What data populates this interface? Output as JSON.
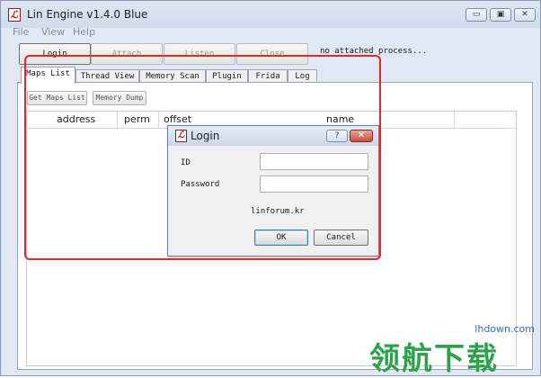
{
  "window": {
    "title": "Lin Engine v1.4.0 Blue",
    "app_icon": "ℒ",
    "controls": [
      "▭",
      "▣",
      "✕"
    ]
  },
  "menu": [
    "File",
    "View",
    "Help"
  ],
  "toolbar": {
    "buttons": [
      "Login",
      "Attach",
      "Listen",
      "Close"
    ],
    "status": "no attached process..."
  },
  "tabs": [
    "Maps List",
    "Thread View",
    "Memory Scan",
    "Plugin",
    "Frida",
    "Log"
  ],
  "maps_list": {
    "buttons": [
      "Get Maps List",
      "Memory Dump"
    ],
    "columns": [
      "address",
      "perm",
      "offset",
      "name"
    ]
  },
  "login_dialog": {
    "title": "Login",
    "icon": "ℒ",
    "help": "?",
    "close": "✕",
    "id_label": "ID",
    "password_label": "Password",
    "id_value": "",
    "password_value": "",
    "site": "linforum.kr",
    "ok": "OK",
    "cancel": "Cancel"
  },
  "watermark": {
    "text": "领航下载",
    "domain": "lhdown.com"
  },
  "colors": {
    "highlight": "#e22828",
    "watermark": "#2ea24a"
  }
}
